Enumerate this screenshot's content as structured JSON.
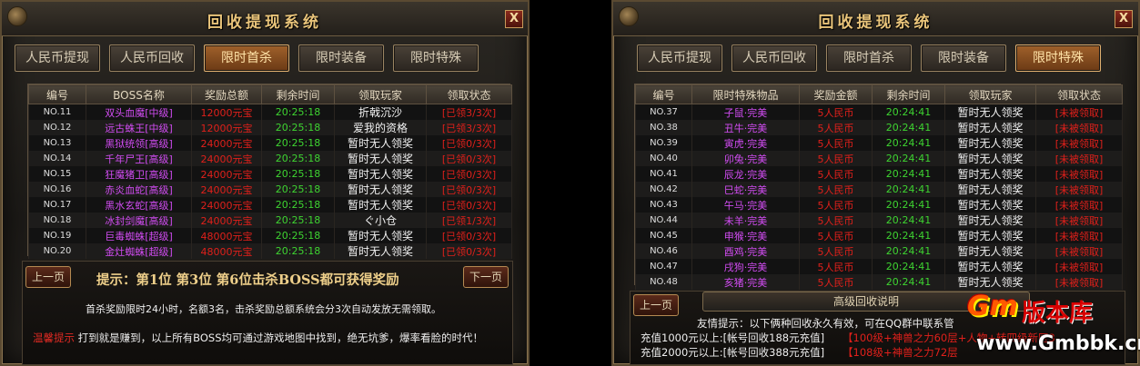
{
  "left": {
    "title": "回收提现系统",
    "close": "X",
    "tabs": [
      "人民币提现",
      "人民币回收",
      "限时首杀",
      "限时装备",
      "限时特殊"
    ],
    "active_tab": 2,
    "headers": [
      "编号",
      "BOSS名称",
      "奖励总额",
      "剩余时间",
      "领取玩家",
      "领取状态"
    ],
    "rows": [
      [
        "NO.11",
        "双头血魔[中级]",
        "12000元宝",
        "20:25:18",
        "折戟沉沙",
        "[已领3/3次]"
      ],
      [
        "NO.12",
        "远古蛛王[中级]",
        "12000元宝",
        "20:25:18",
        "爱我的资格",
        "[已领3/3次]"
      ],
      [
        "NO.13",
        "黑狱统领[高级]",
        "24000元宝",
        "20:25:18",
        "暂时无人领奖",
        "[已领0/3次]"
      ],
      [
        "NO.14",
        "千年尸王[高级]",
        "24000元宝",
        "20:25:18",
        "暂时无人领奖",
        "[已领0/3次]"
      ],
      [
        "NO.15",
        "狂魔猪卫[高级]",
        "24000元宝",
        "20:25:18",
        "暂时无人领奖",
        "[已领0/3次]"
      ],
      [
        "NO.16",
        "赤炎血蛇[高级]",
        "24000元宝",
        "20:25:18",
        "暂时无人领奖",
        "[已领0/3次]"
      ],
      [
        "NO.17",
        "黑水玄蛇[高级]",
        "24000元宝",
        "20:25:18",
        "暂时无人领奖",
        "[已领0/3次]"
      ],
      [
        "NO.18",
        "冰封剑魔[高级]",
        "24000元宝",
        "20:25:18",
        "ぐ小仓",
        "[已领1/3次]"
      ],
      [
        "NO.19",
        "巨毒蜘蛛[超级]",
        "48000元宝",
        "20:25:18",
        "暂时无人领奖",
        "[已领0/3次]"
      ],
      [
        "NO.20",
        "金灶蜘蛛[超级]",
        "48000元宝",
        "20:25:18",
        "暂时无人领奖",
        "[已领0/3次]"
      ]
    ],
    "prev_label": "上一页",
    "next_label": "下一页",
    "hint": "提示：第1位  第3位  第6位击杀BOSS都可获得奖励",
    "info_line": "首杀奖励限时24小时，名额3名，击杀奖励总额系统会分3次自动发放无需领取。",
    "warm_label": "温馨提示",
    "warm_text": "打到就是赚到，以上所有BOSS均可通过游戏地图中找到，绝无坑爹，爆率看脸的时代！"
  },
  "right": {
    "title": "回收提现系统",
    "close": "X",
    "tabs": [
      "人民币提现",
      "人民币回收",
      "限时首杀",
      "限时装备",
      "限时特殊"
    ],
    "active_tab": 4,
    "headers": [
      "编号",
      "限时特殊物品",
      "奖励金额",
      "剩余时间",
      "领取玩家",
      "领取状态"
    ],
    "rows": [
      [
        "NO.37",
        "子鼠·完美",
        "5人民币",
        "20:24:41",
        "暂时无人领奖",
        "[未被领取]"
      ],
      [
        "NO.38",
        "丑牛·完美",
        "5人民币",
        "20:24:41",
        "暂时无人领奖",
        "[未被领取]"
      ],
      [
        "NO.39",
        "寅虎·完美",
        "5人民币",
        "20:24:41",
        "暂时无人领奖",
        "[未被领取]"
      ],
      [
        "NO.40",
        "卯兔·完美",
        "5人民币",
        "20:24:41",
        "暂时无人领奖",
        "[未被领取]"
      ],
      [
        "NO.41",
        "辰龙·完美",
        "5人民币",
        "20:24:41",
        "暂时无人领奖",
        "[未被领取]"
      ],
      [
        "NO.42",
        "巳蛇·完美",
        "5人民币",
        "20:24:41",
        "暂时无人领奖",
        "[未被领取]"
      ],
      [
        "NO.43",
        "午马·完美",
        "5人民币",
        "20:24:41",
        "暂时无人领奖",
        "[未被领取]"
      ],
      [
        "NO.44",
        "未羊·完美",
        "5人民币",
        "20:24:41",
        "暂时无人领奖",
        "[未被领取]"
      ],
      [
        "NO.45",
        "申猴·完美",
        "5人民币",
        "20:24:41",
        "暂时无人领奖",
        "[未被领取]"
      ],
      [
        "NO.46",
        "酉鸡·完美",
        "5人民币",
        "20:24:41",
        "暂时无人领奖",
        "[未被领取]"
      ],
      [
        "NO.47",
        "戌狗·完美",
        "5人民币",
        "20:24:41",
        "暂时无人领奖",
        "[未被领取]"
      ],
      [
        "NO.48",
        "亥猪·完美",
        "5人民币",
        "20:24:41",
        "暂时无人领奖",
        "[未被领取]"
      ]
    ],
    "prev_label": "上一页",
    "adv_label": "高级回收说明",
    "friendly_tip": "友情提示：以下俩种回收永久有效，可在QQ群中联系管",
    "recharge1_left": "充值1000元以上:[帐号回收188元充值]",
    "recharge1_right": "【100级+神兽之力60层+人物+转四级新区3",
    "recharge2_left": "充值2000元以上:[帐号回收388元充值]",
    "recharge2_right": "【108级+神兽之力72层"
  },
  "watermark": {
    "logo": "Gm",
    "brand": "版本库",
    "url": "www.Gmbbk.cn"
  }
}
